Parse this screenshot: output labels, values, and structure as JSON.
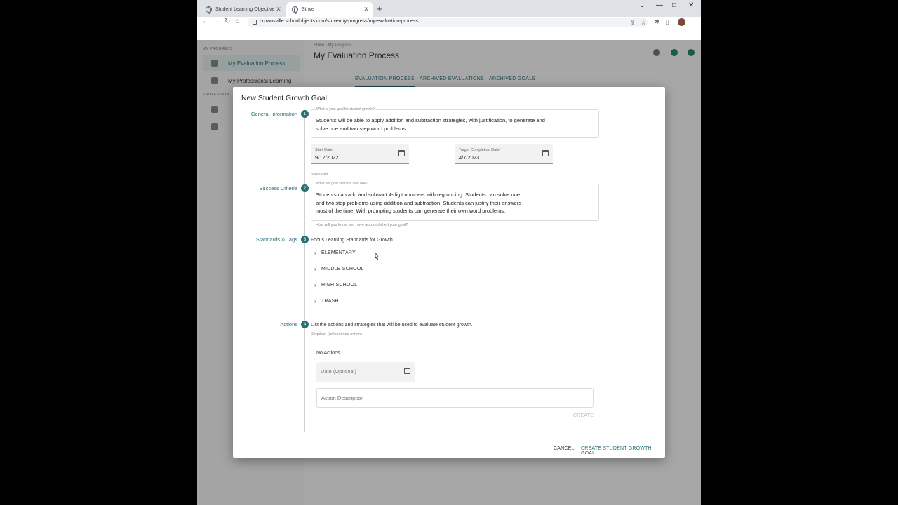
{
  "browser": {
    "tabs": [
      {
        "label": "Student Learning Objectives For",
        "active": false
      },
      {
        "label": "Strive",
        "active": true
      }
    ],
    "url": "brownsville.schoolobjects.com/strive/my-progress/my-evaluation-process"
  },
  "app": {
    "sidebar": {
      "section1": "MY PROGRESS",
      "item1": "My Evaluation Process",
      "item2": "My Professional Learning",
      "section2": "PROFESSION"
    },
    "breadcrumb": "Strive  ›  My Progress",
    "title": "My Evaluation Process",
    "tabs": [
      "EVALUATION PROCESS",
      "ARCHIVED EVALUATIONS",
      "ARCHIVED GOALS"
    ]
  },
  "modal": {
    "title": "New Student Growth Goal",
    "steps": [
      {
        "num": "1",
        "label": "General Information"
      },
      {
        "num": "2",
        "label": "Success Criteria"
      },
      {
        "num": "3",
        "label": "Standards & Tags"
      },
      {
        "num": "4",
        "label": "Actions"
      }
    ],
    "goal": {
      "label": "What is your goal for student growth?",
      "value": "Students will be able to apply addition and subtraction strategies, with justification, to generate and\nsolve one and two step word problems."
    },
    "start_date": {
      "label": "Start Date",
      "value": "9/12/2022"
    },
    "target_date": {
      "label": "Target Completion Date*",
      "value": "4/7/2023"
    },
    "required_note": "*Required",
    "success": {
      "label": "What will goal success look like?",
      "value": "Students can add and subtract 4-digit numbers with regrouping. Students can solve one\nand two step problems using addition and subtraction. Students can justify their answers\nmost of the time. With prompting students can generate their own word problems.",
      "helper": "How will you know you have accomplished your goal?"
    },
    "standards": {
      "heading": "Focus Learning Standards for Growth",
      "items": [
        "ELEMENTARY",
        "MIDDLE SCHOOL",
        "HIGH SCHOOL",
        "TRASH"
      ]
    },
    "actions": {
      "description": "List the actions and strategies that will be used to evaluate student growth.",
      "required": "Required (At least one action)",
      "empty": "No Actions",
      "date_placeholder": "Date (Optional)",
      "desc_placeholder": "Action Description",
      "create": "CREATE"
    },
    "cancel": "CANCEL",
    "submit": "CREATE STUDENT GROWTH GOAL"
  },
  "colors": {
    "accent": "#2c6f77"
  }
}
